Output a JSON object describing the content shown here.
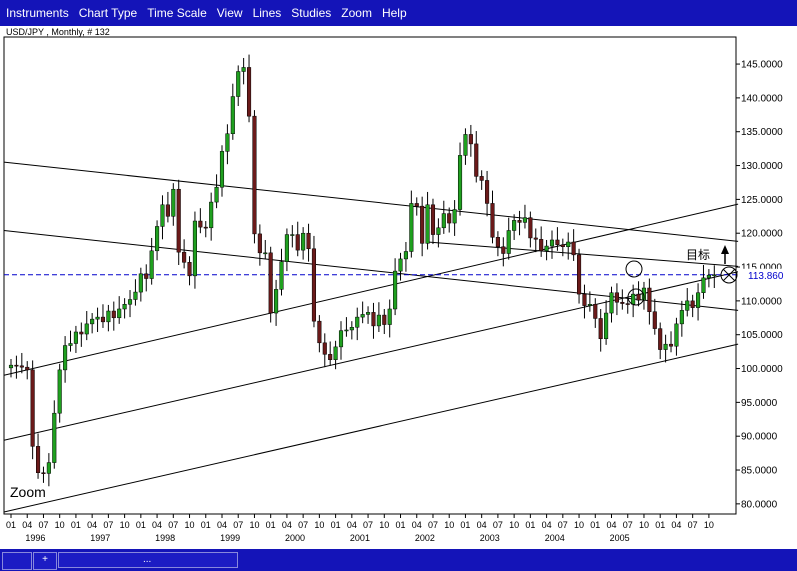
{
  "menu": {
    "items": [
      "Instruments",
      "Chart Type",
      "Time Scale",
      "View",
      "Lines",
      "Studies",
      "Zoom",
      "Help"
    ]
  },
  "chart": {
    "header": "USD/JPY , Monthly, # 132",
    "zoom_label": "Zoom",
    "target_label": "目标",
    "current_price_label": "113.860"
  },
  "status": {
    "cells": [
      "",
      "+",
      "..."
    ]
  },
  "colors": {
    "menu_bg": "#1414b8",
    "up_candle": "#1fa01f",
    "down_candle": "#6b1a1a",
    "price_line": "#0000cc"
  },
  "chart_data": {
    "type": "candlestick",
    "instrument": "USD/JPY",
    "interval": "Monthly",
    "ylim": [
      78.5,
      149
    ],
    "y_ticks": [
      145,
      140,
      135,
      130,
      125,
      120,
      115,
      110,
      105,
      100,
      95,
      90,
      85,
      80
    ],
    "y_tick_labels": [
      "145.0000",
      "140.0000",
      "135.0000",
      "130.0000",
      "125.0000",
      "120.0000",
      "115.0000",
      "110.0000",
      "105.0000",
      "100.0000",
      "95.0000",
      "90.0000",
      "85.0000",
      "80.0000"
    ],
    "x_month_labels": [
      "01",
      "04",
      "07",
      "10"
    ],
    "x_year_labels": [
      "1996",
      "1997",
      "1998",
      "1999",
      "2000",
      "2001",
      "2002",
      "2003",
      "2004",
      "2005"
    ],
    "current_price": 113.86,
    "closes": [
      100.5,
      100.4,
      100.2,
      99.8,
      88.5,
      84.6,
      84.5,
      86.1,
      93.4,
      99.8,
      103.4,
      103.7,
      105.4,
      105.1,
      106.6,
      107.3,
      107.6,
      106.9,
      108.5,
      107.5,
      108.8,
      109.5,
      110.2,
      111.3,
      114.0,
      113.3,
      117.4,
      121.0,
      124.2,
      122.5,
      126.5,
      117.2,
      115.7,
      113.7,
      121.8,
      120.9,
      120.8,
      124.6,
      126.8,
      132.1,
      134.7,
      140.2,
      143.9,
      144.5,
      137.3,
      119.9,
      117.1,
      117.1,
      108.2,
      111.7,
      115.8,
      119.8,
      119.8,
      117.5,
      120.0,
      117.7,
      107.0,
      103.8,
      102.1,
      101.3,
      103.2,
      105.6,
      105.7,
      106.1,
      107.6,
      108.0,
      108.3,
      106.3,
      107.9,
      106.5,
      108.8,
      114.4,
      116.2,
      117.3,
      124.4,
      124.0,
      118.5,
      124.2,
      119.8,
      120.8,
      122.9,
      121.5,
      123.5,
      131.5,
      134.6,
      133.2,
      128.4,
      127.8,
      124.4,
      119.4,
      118.0,
      117.0,
      120.4,
      121.9,
      121.6,
      122.3,
      119.3,
      119.1,
      117.4,
      118.1,
      119.0,
      118.3,
      118.0,
      118.7,
      116.8,
      111.0,
      109.3,
      109.5,
      107.4,
      104.4,
      108.2,
      111.2,
      109.8,
      109.6,
      109.5,
      111.0,
      110.1,
      111.9,
      108.4,
      105.9,
      102.8,
      103.6,
      103.3,
      106.6,
      108.6,
      110.0,
      109.0,
      111.2,
      113.4,
      113.8,
      113.86
    ]
  }
}
